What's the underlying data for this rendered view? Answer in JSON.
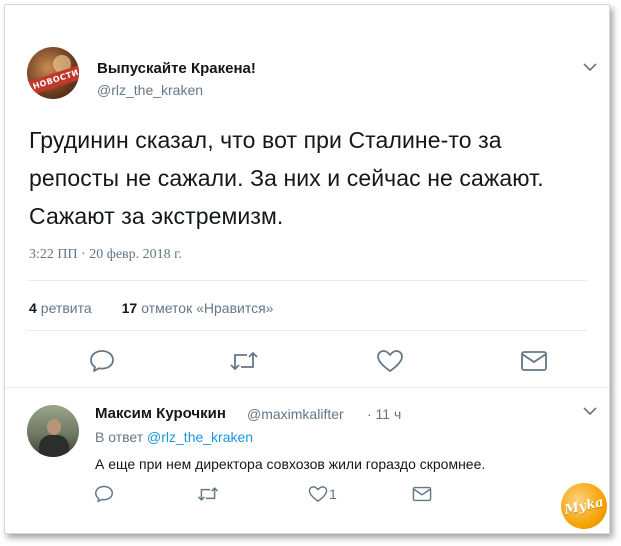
{
  "tweet": {
    "author_name": "Выпускайте Кракена!",
    "author_handle": "@rlz_the_kraken",
    "avatar_label": "НОВОСТИ",
    "text": "Грудинин сказал, что вот при Сталине-то за репосты не сажали. За них и сейчас не сажают. Сажают за экстремизм.",
    "timestamp": "3:22 ПП · 20 февр. 2018 г.",
    "retweets_count": "4",
    "retweets_label": "ретвита",
    "likes_count": "17",
    "likes_label": "отметок «Нравится»",
    "icons": [
      "reply-icon",
      "retweet-icon",
      "like-icon",
      "message-icon"
    ]
  },
  "reply": {
    "author_name": "Максим Курочкин",
    "author_handle": "@maximkalifter",
    "time": "· 11 ч",
    "reply_to_prefix": "В ответ",
    "reply_to_handle": "@rlz_the_kraken",
    "text": "А еще при нем директора совхозов жили гораздо скромнее.",
    "like_count": "1",
    "icons": [
      "reply-icon",
      "retweet-icon",
      "like-icon",
      "message-icon"
    ]
  },
  "watermark": {
    "text": "Муkа"
  },
  "colors": {
    "text": "#14171a",
    "muted": "#657786",
    "link": "#1b95e0",
    "icon": "#657786",
    "divider": "#e6ecf0"
  }
}
